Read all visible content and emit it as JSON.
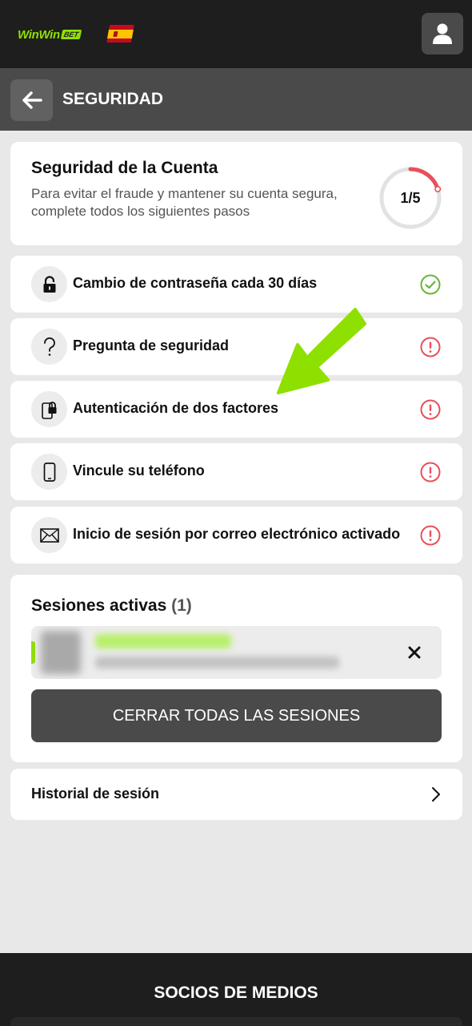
{
  "header": {
    "logo_text": "WinWin",
    "logo_badge": "BET",
    "logo_color": "#8ee000",
    "flag": "spain-flag",
    "user_icon": "user-icon"
  },
  "subheader": {
    "back_icon": "arrow-left-icon",
    "title": "SEGURIDAD"
  },
  "summary": {
    "title": "Seguridad de la Cuenta",
    "description": "Para evitar el fraude y mantener su cuenta segura, complete todos los siguientes pasos",
    "progress_label": "1/5",
    "progress_fraction": 0.2,
    "progress_color": "#e8505b"
  },
  "steps": [
    {
      "label": "Cambio de contraseña cada 30 días",
      "icon": "lock-icon",
      "status": "completed",
      "status_icon": "check-circle-icon"
    },
    {
      "label": "Pregunta de seguridad",
      "icon": "question-icon",
      "status": "pending",
      "status_icon": "alert-circle-icon"
    },
    {
      "label": "Autenticación de dos factores",
      "icon": "phone-lock-icon",
      "status": "pending",
      "status_icon": "alert-circle-icon"
    },
    {
      "label": "Vincule su teléfono",
      "icon": "smartphone-icon",
      "status": "pending",
      "status_icon": "alert-circle-icon"
    },
    {
      "label": "Inicio de sesión por correo electrónico activado",
      "icon": "envelope-icon",
      "status": "pending",
      "status_icon": "alert-circle-icon"
    }
  ],
  "status_colors": {
    "completed": "#6ab43c",
    "pending": "#e8505b"
  },
  "sessions": {
    "title": "Sesiones activas",
    "count": "(1)",
    "close_all_label": "CERRAR TODAS LAS SESIONES"
  },
  "history": {
    "label": "Historial de sesión"
  },
  "footer": {
    "title": "SOCIOS DE MEDIOS"
  },
  "annotation": {
    "arrow_color": "#8ee000"
  }
}
